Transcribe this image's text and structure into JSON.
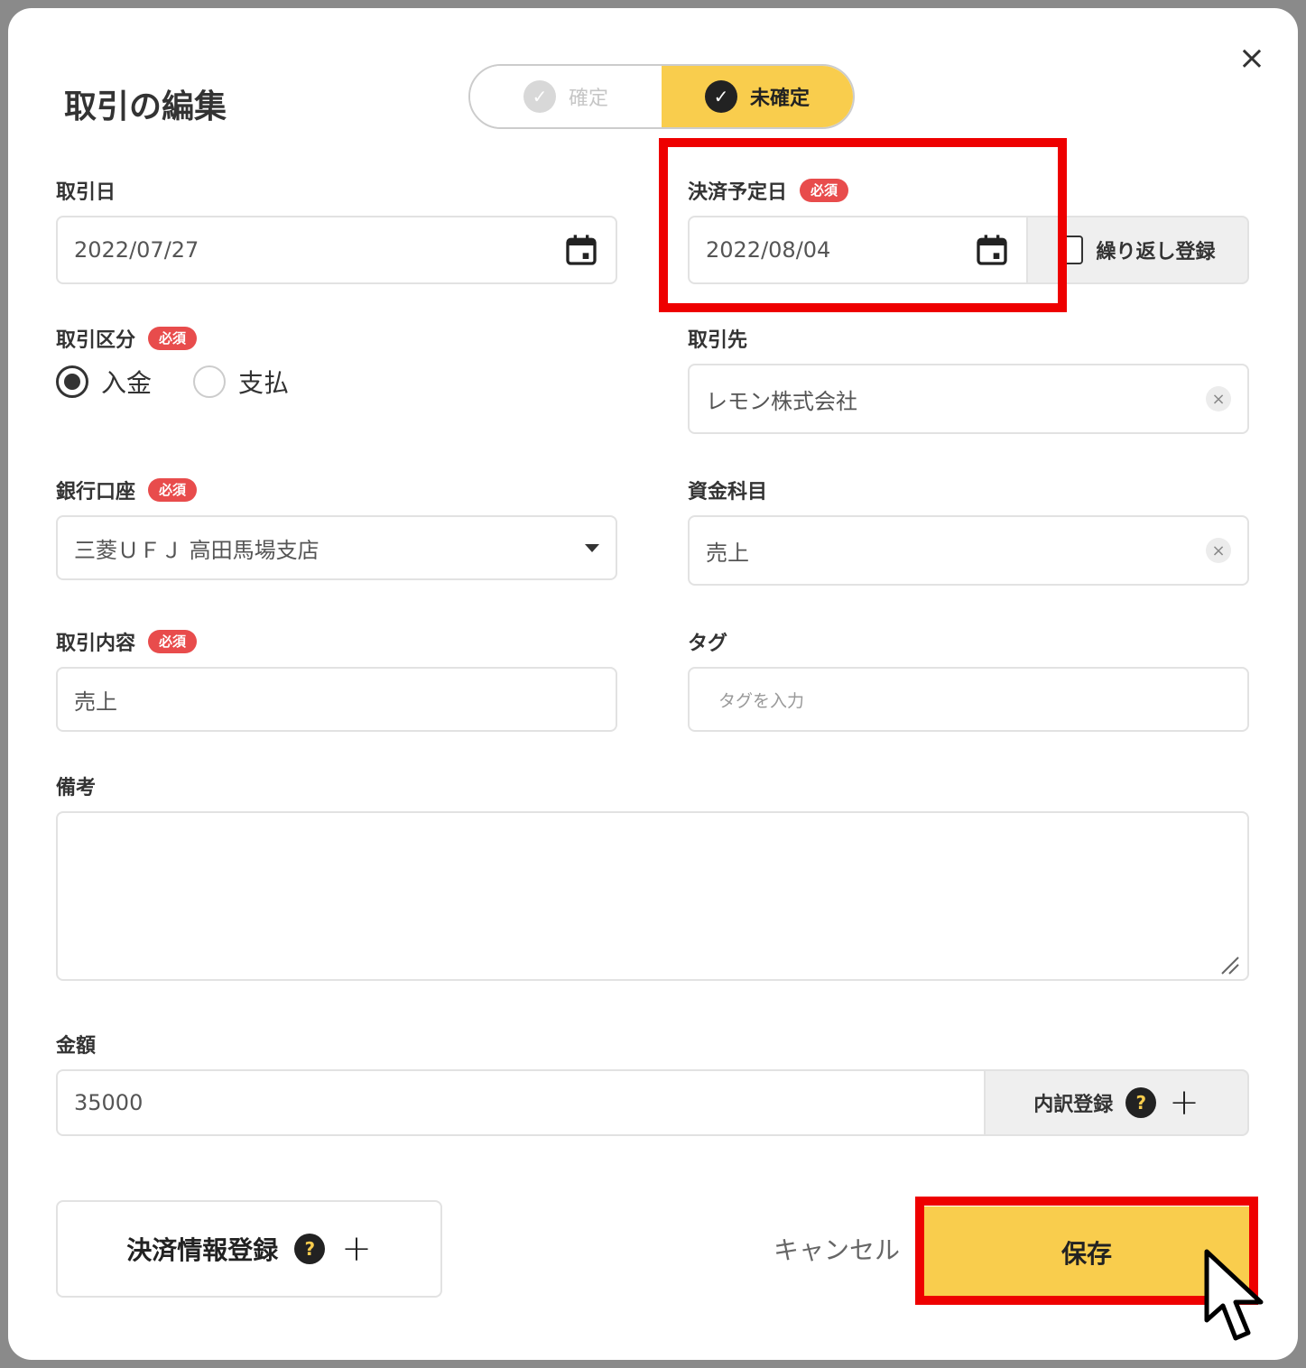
{
  "dialog": {
    "title": "取引の編集",
    "close_icon": "×",
    "status_toggle": {
      "confirmed_label": "確定",
      "unconfirmed_label": "未確定",
      "selected": "未確定"
    }
  },
  "fields": {
    "transaction_date": {
      "label": "取引日",
      "value": "2022/07/27"
    },
    "settlement_date": {
      "label": "決済予定日",
      "required": "必須",
      "value": "2022/08/04",
      "repeat_label": "繰り返し登録"
    },
    "transaction_type": {
      "label": "取引区分",
      "required": "必須",
      "options": [
        "入金",
        "支払"
      ],
      "selected": "入金"
    },
    "partner": {
      "label": "取引先",
      "value": "レモン株式会社"
    },
    "bank_account": {
      "label": "銀行口座",
      "required": "必須",
      "value": "三菱ＵＦＪ 高田馬場支店"
    },
    "fund_category": {
      "label": "資金科目",
      "value": "売上"
    },
    "description": {
      "label": "取引内容",
      "required": "必須",
      "value": "売上"
    },
    "tags": {
      "label": "タグ",
      "placeholder": "タグを入力"
    },
    "remarks": {
      "label": "備考",
      "value": ""
    },
    "amount": {
      "label": "金額",
      "value": "35000",
      "breakdown_label": "内訳登録"
    }
  },
  "footer": {
    "settlement_info_label": "決済情報登録",
    "cancel_label": "キャンセル",
    "save_label": "保存"
  },
  "icons": {
    "help": "?",
    "plus": "+",
    "clear": "×",
    "check": "✓"
  },
  "colors": {
    "accent": "#f9cd4d",
    "required_badge": "#e84c4c",
    "highlight": "#ee0000"
  }
}
